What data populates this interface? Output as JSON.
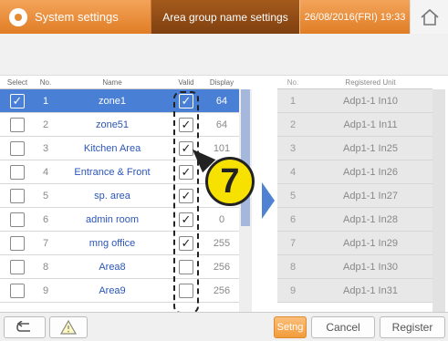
{
  "header": {
    "title": "System settings",
    "section": "Area group name settings",
    "datetime": "26/08/2016(FRI) 19:33"
  },
  "left_table": {
    "headers": {
      "select": "Select",
      "no": "No.",
      "name": "Name",
      "valid": "Valid",
      "display": "Display"
    },
    "rows": [
      {
        "no": "1",
        "name": "zone1",
        "valid": "✓",
        "display": "64",
        "selected": true
      },
      {
        "no": "2",
        "name": "zone51",
        "valid": "✓",
        "display": "64",
        "selected": false
      },
      {
        "no": "3",
        "name": "Kitchen Area",
        "valid": "✓",
        "display": "101",
        "selected": false
      },
      {
        "no": "4",
        "name": "Entrance & Front",
        "valid": "✓",
        "display": "",
        "selected": false
      },
      {
        "no": "5",
        "name": "sp. area",
        "valid": "✓",
        "display": "",
        "selected": false
      },
      {
        "no": "6",
        "name": "admin room",
        "valid": "✓",
        "display": "0",
        "selected": false
      },
      {
        "no": "7",
        "name": "mng office",
        "valid": "✓",
        "display": "255",
        "selected": false
      },
      {
        "no": "8",
        "name": "Area8",
        "valid": "",
        "display": "256",
        "selected": false
      },
      {
        "no": "9",
        "name": "Area9",
        "valid": "",
        "display": "256",
        "selected": false
      }
    ]
  },
  "right_table": {
    "headers": {
      "no": "No.",
      "unit": "Registered Unit"
    },
    "rows": [
      {
        "no": "1",
        "unit": "Adp1-1 In10"
      },
      {
        "no": "2",
        "unit": "Adp1-1 In11"
      },
      {
        "no": "3",
        "unit": "Adp1-1 In25"
      },
      {
        "no": "4",
        "unit": "Adp1-1 In26"
      },
      {
        "no": "5",
        "unit": "Adp1-1 In27"
      },
      {
        "no": "6",
        "unit": "Adp1-1 In28"
      },
      {
        "no": "7",
        "unit": "Adp1-1 In29"
      },
      {
        "no": "8",
        "unit": "Adp1-1 In30"
      },
      {
        "no": "9",
        "unit": "Adp1-1 In31"
      }
    ]
  },
  "annotation": {
    "label": "7"
  },
  "footer": {
    "back_icon": "return-arrow-icon",
    "warning_icon": "warning-triangle-icon",
    "setng": "Setng",
    "cancel": "Cancel",
    "register": "Register"
  },
  "colors": {
    "header_orange": "#e8893a",
    "header_dark": "#8a4614",
    "selected_row": "#4a7fd6",
    "name_text": "#2b55b8",
    "callout": "#f6e100"
  }
}
